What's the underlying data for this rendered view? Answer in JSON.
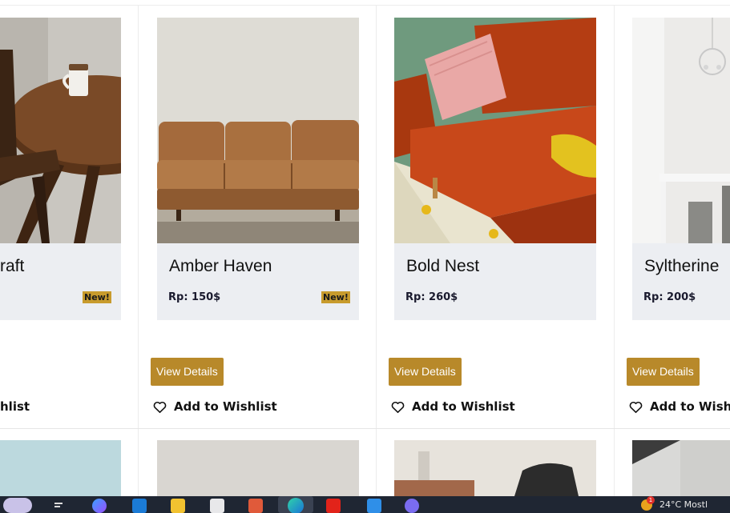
{
  "products": [
    {
      "title": "raft",
      "price": "",
      "badge": "New!",
      "button": "",
      "wishlist": "hlist"
    },
    {
      "title": "Amber Haven",
      "price": "Rp: 150$",
      "badge": "New!",
      "button": "View Details",
      "wishlist": "Add to Wishlist"
    },
    {
      "title": "Bold Nest",
      "price": "Rp: 260$",
      "badge": "",
      "button": "View Details",
      "wishlist": "Add to Wishlist"
    },
    {
      "title": "Syltherine",
      "price": "Rp: 200$",
      "badge": "",
      "button": "View Details",
      "wishlist": "Add to Wishl"
    }
  ],
  "taskbar": {
    "weather": "24°C Mostl",
    "notification_count": "1"
  },
  "colors": {
    "button": "#b8892a",
    "badge": "#c89b2d",
    "info_panel": "#eceef2"
  },
  "icons": [
    "heart-icon",
    "search-icon",
    "copilot-icon",
    "edge-icon",
    "file-explorer-icon",
    "store-icon",
    "youtube-icon",
    "vscode-icon",
    "discord-icon"
  ]
}
